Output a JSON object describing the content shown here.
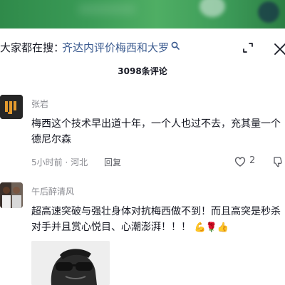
{
  "search": {
    "prefix": "大家都在搜：",
    "query": "齐达内评价梅西和大罗"
  },
  "comments_header": {
    "count_label": "3098条评论"
  },
  "comments": [
    {
      "username": "张岩",
      "text": "梅西这个技术早出道十年，一个人也过不去，充其量一个德尼尔森",
      "time": "5小时前",
      "location": "河北",
      "reply_label": "回复",
      "likes": "2"
    },
    {
      "username": "午后醉清风",
      "text": "超高速突破与强壮身体对抗梅西做不到！而且高突是秒杀对手并且赏心悦目、心潮澎湃！！！",
      "emojis": [
        "💪",
        "🌹",
        "👍"
      ]
    }
  ],
  "colors": {
    "link": "#3a5a8f",
    "muted": "#8a8b91",
    "text": "#161823"
  }
}
